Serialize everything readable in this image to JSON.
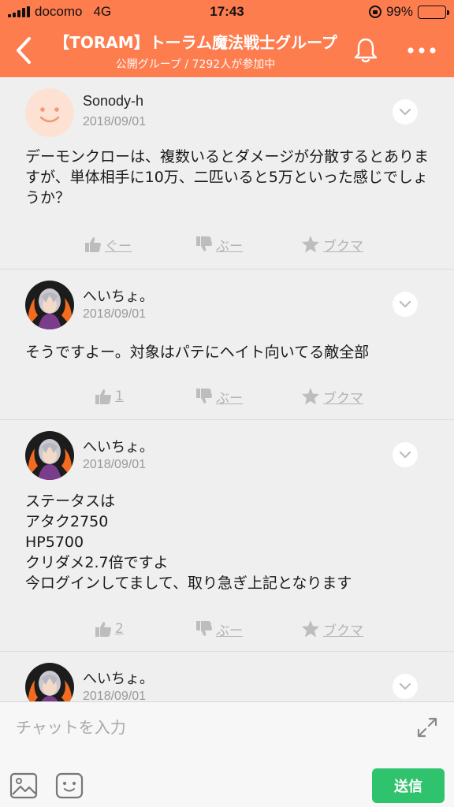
{
  "status_bar": {
    "carrier": "docomo",
    "network": "4G",
    "time": "17:43",
    "battery": "99%",
    "battery_level": 0.99
  },
  "header": {
    "title": "【TORAM】トーラム魔法戦士グループ",
    "subtitle": "公開グループ / 7292人が参加中",
    "icons": [
      "back-arrow-icon",
      "bell-icon",
      "more-icon"
    ]
  },
  "posts": [
    {
      "author": "Sonody-h",
      "date": "2018/09/01",
      "text": "デーモンクローは、複数いるとダメージが分散するとありますが、単体相手に10万、二匹いると5万といった感じでしょうか？",
      "like_label": "ぐー",
      "dislike_label": "ぶー",
      "bookmark_label": "ブクマ"
    },
    {
      "author": "へいちょ。",
      "date": "2018/09/01",
      "text": "そうですよー。対象はパテにヘイト向いてる敵全部",
      "like_label": "1",
      "dislike_label": "ぶー",
      "bookmark_label": "ブクマ"
    },
    {
      "author": "へいちょ。",
      "date": "2018/09/01",
      "text": "ステータスは\nアタク2750\nHP5700\nクリダメ2.7倍ですよ\n今ログインしてまして、取り急ぎ上記となります",
      "like_label": "2",
      "dislike_label": "ぶー",
      "bookmark_label": "ブクマ"
    },
    {
      "author": "へいちょ。",
      "date": "2018/09/01"
    }
  ],
  "composer": {
    "placeholder": "チャットを入力",
    "send_label": "送信"
  },
  "colors": {
    "brand": "#fd7d4f",
    "send": "#2ec36c",
    "muted": "#b3b3b3"
  }
}
